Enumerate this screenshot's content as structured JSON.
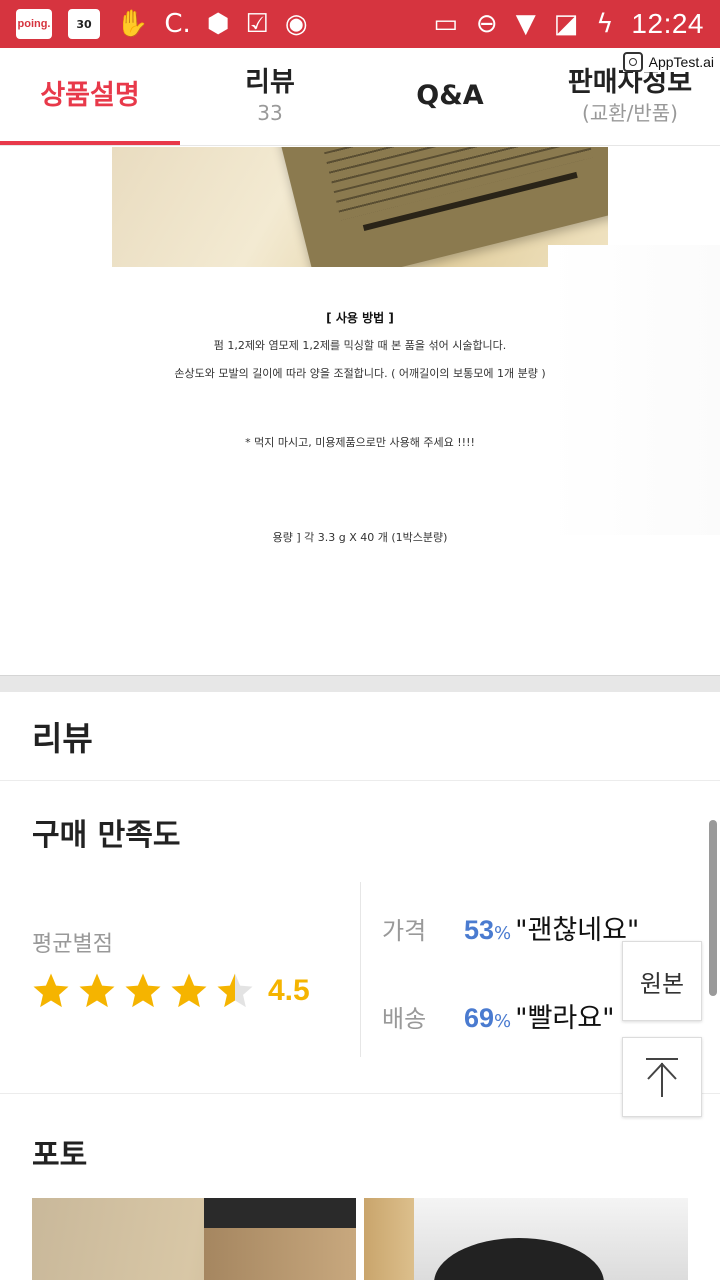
{
  "status_bar": {
    "app_badge": "poing.",
    "calendar_day": "30",
    "time": "12:24",
    "icons": [
      "poing-app-icon",
      "calendar-icon",
      "hand-icon",
      "c-icon",
      "app-icon",
      "check-icon",
      "record-icon",
      "cast-icon",
      "do-not-disturb-icon",
      "wifi-icon",
      "no-sim-icon",
      "battery-charging-icon"
    ]
  },
  "overlay": {
    "label": "AppTest.ai"
  },
  "tabs": [
    {
      "label": "상품설명",
      "sub": ""
    },
    {
      "label": "리뷰",
      "sub": "33"
    },
    {
      "label": "Q&A",
      "sub": ""
    },
    {
      "label": "판매자정보",
      "sub": "(교환/반품)"
    }
  ],
  "description": {
    "heading": "[ 사용 방법 ]",
    "line1": "펌 1,2제와 염모제 1,2제를 믹싱할 때 본 품을 섞어 시술합니다.",
    "line2": "손상도와 모발의 길이에 따라 양을 조절합니다. ( 어깨길이의 보통모에 1개 분량 )",
    "warning": "* 먹지 마시고, 미용제품으로만 사용해 주세요 !!!!",
    "volume": "용량 ] 각 3.3 g X 40 개 (1박스분량)"
  },
  "review": {
    "title": "리뷰",
    "satisfaction_title": "구매 만족도",
    "average_label": "평균별점",
    "rating": "4.5",
    "rating_value": 4.5,
    "stats": [
      {
        "label": "가격",
        "pct": "53",
        "pct_sign": "%",
        "text": "\"괜찮네요\""
      },
      {
        "label": "배송",
        "pct": "69",
        "pct_sign": "%",
        "text": "\"빨라요\""
      }
    ],
    "photo_title": "포토"
  },
  "floating": {
    "original_label": "원본"
  },
  "colors": {
    "brand_red": "#d6343f",
    "tab_active": "#e8394a",
    "star": "#f5b400",
    "percent_blue": "#4a7bd0"
  }
}
